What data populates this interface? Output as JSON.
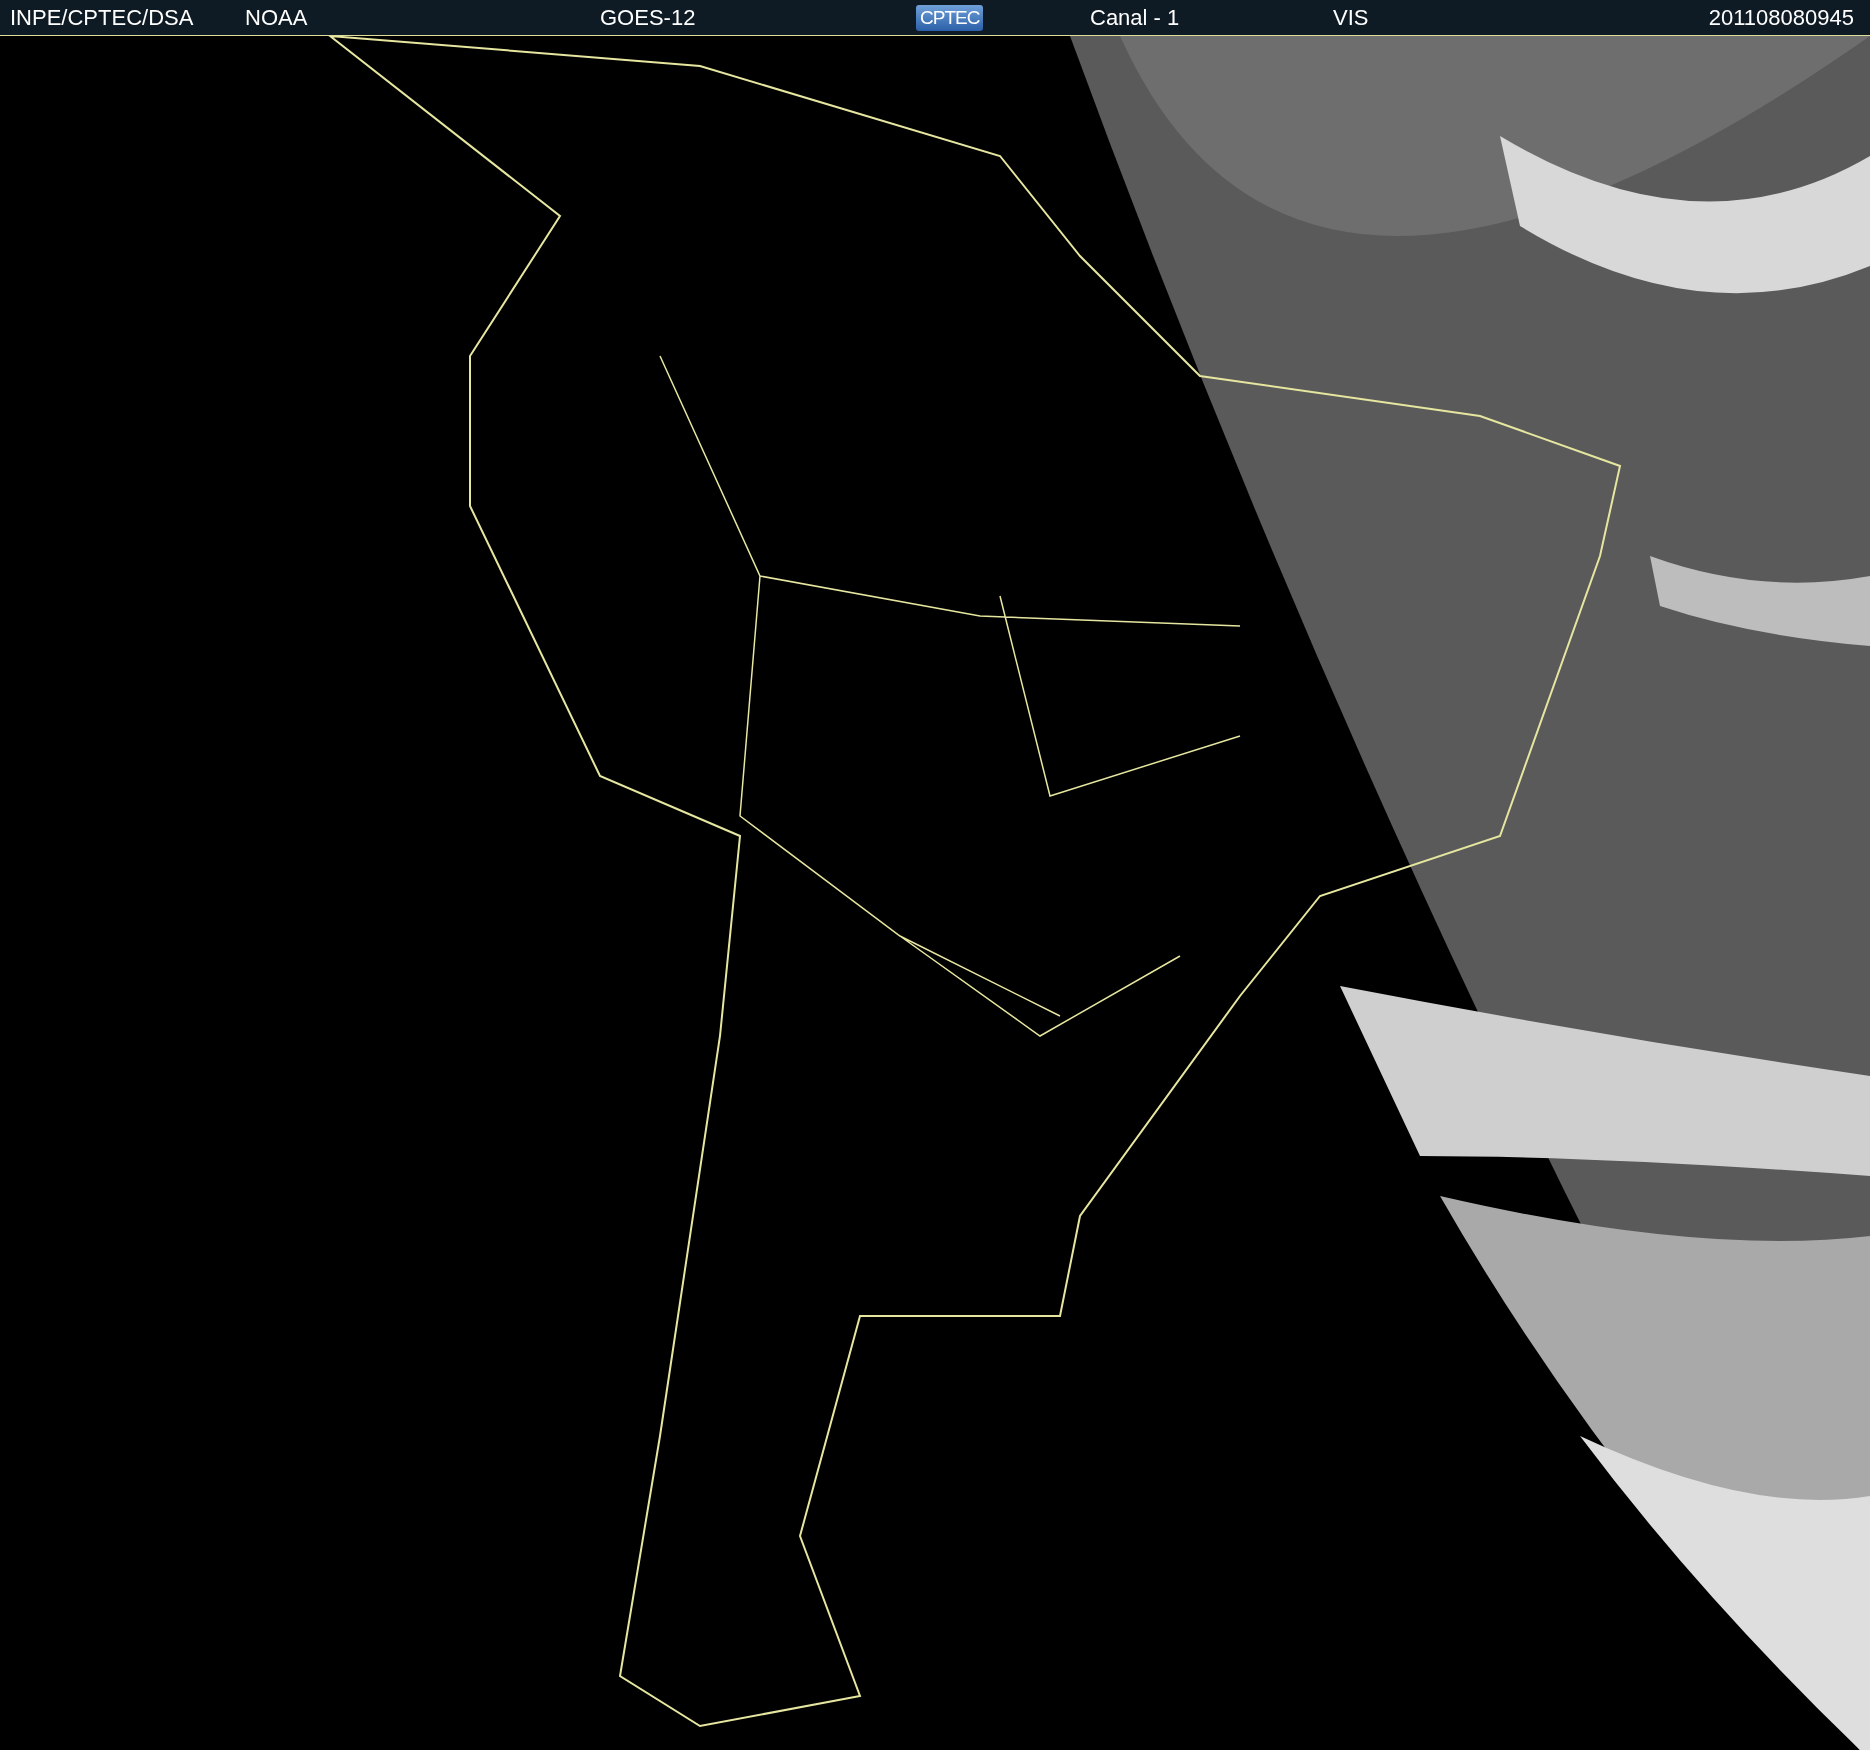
{
  "header": {
    "source": "INPE/CPTEC/DSA",
    "agency": "NOAA",
    "satellite": "GOES-12",
    "logo": "CPTEC",
    "channel": "Canal - 1",
    "band": "VIS",
    "timestamp": "201108080945"
  }
}
